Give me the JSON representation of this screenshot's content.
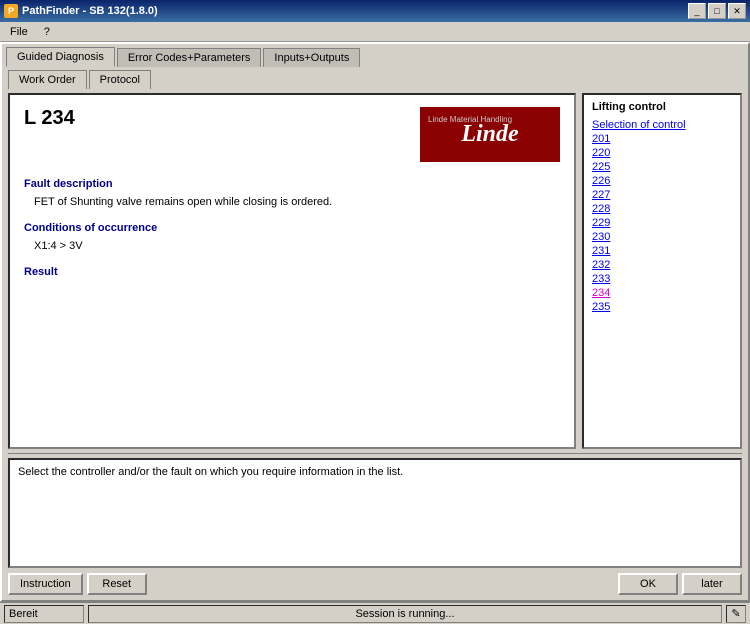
{
  "titlebar": {
    "title": "PathFinder - SB 132(1.8.0)",
    "minimize_label": "_",
    "maximize_label": "□",
    "close_label": "✕",
    "icon_label": "P"
  },
  "menubar": {
    "items": [
      {
        "id": "file",
        "label": "File"
      },
      {
        "id": "help",
        "label": "?"
      }
    ]
  },
  "tabs": {
    "main": [
      {
        "id": "guided-diagnosis",
        "label": "Guided Diagnosis",
        "active": true
      },
      {
        "id": "error-codes",
        "label": "Error Codes+Parameters",
        "active": false
      },
      {
        "id": "inputs-outputs",
        "label": "Inputs+Outputs",
        "active": false
      }
    ],
    "sub": [
      {
        "id": "work-order",
        "label": "Work Order",
        "active": true
      },
      {
        "id": "protocol",
        "label": "Protocol",
        "active": false
      }
    ]
  },
  "left_panel": {
    "device_id": "L 234",
    "logo_small_text": "Linde Material Handling",
    "logo_main_text": "Linde",
    "fault_description_label": "Fault description",
    "fault_description_text": "FET of Shunting valve remains open while closing is ordered.",
    "conditions_label": "Conditions of occurrence",
    "conditions_text": "X1:4 > 3V",
    "result_label": "Result"
  },
  "right_panel": {
    "title": "Lifting control",
    "selection_link": "Selection of control",
    "links": [
      {
        "id": "201",
        "label": "201",
        "selected": false
      },
      {
        "id": "220",
        "label": "220",
        "selected": false
      },
      {
        "id": "225",
        "label": "225",
        "selected": false
      },
      {
        "id": "226",
        "label": "226",
        "selected": false
      },
      {
        "id": "227",
        "label": "227",
        "selected": false
      },
      {
        "id": "228",
        "label": "228",
        "selected": false
      },
      {
        "id": "229",
        "label": "229",
        "selected": false
      },
      {
        "id": "230",
        "label": "230",
        "selected": false
      },
      {
        "id": "231",
        "label": "231",
        "selected": false
      },
      {
        "id": "232",
        "label": "232",
        "selected": false
      },
      {
        "id": "233",
        "label": "233",
        "selected": false
      },
      {
        "id": "234",
        "label": "234",
        "selected": true
      },
      {
        "id": "235",
        "label": "235",
        "selected": false
      }
    ]
  },
  "bottom_panel": {
    "text": "Select the controller and/or the fault on which you require information in the list."
  },
  "buttons": {
    "instruction": "Instruction",
    "reset": "Reset",
    "ok": "OK",
    "later": "later"
  },
  "statusbar": {
    "left": "Bereit",
    "middle": "Session is running...",
    "right": "✎"
  }
}
